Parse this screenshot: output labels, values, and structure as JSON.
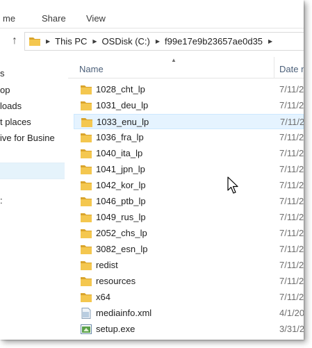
{
  "ribbon": {
    "tabs": [
      {
        "label": "me"
      },
      {
        "label": "Share"
      },
      {
        "label": "View"
      }
    ]
  },
  "address": {
    "crumbs": [
      "This PC",
      "OSDisk (C:)",
      "f99e17e9b23657ae0d35"
    ]
  },
  "nav": {
    "items": [
      {
        "label": "s"
      },
      {
        "label": "op"
      },
      {
        "label": "loads"
      },
      {
        "label": "t places"
      },
      {
        "label": "ive for Busine"
      },
      {
        "label": ":"
      }
    ]
  },
  "columns": {
    "name": "Name",
    "date": "Date m"
  },
  "files": [
    {
      "name": "1028_cht_lp",
      "date": "7/11/2",
      "type": "folder"
    },
    {
      "name": "1031_deu_lp",
      "date": "7/11/2",
      "type": "folder"
    },
    {
      "name": "1033_enu_lp",
      "date": "7/11/2",
      "type": "folder"
    },
    {
      "name": "1036_fra_lp",
      "date": "7/11/2",
      "type": "folder"
    },
    {
      "name": "1040_ita_lp",
      "date": "7/11/2",
      "type": "folder"
    },
    {
      "name": "1041_jpn_lp",
      "date": "7/11/2",
      "type": "folder"
    },
    {
      "name": "1042_kor_lp",
      "date": "7/11/2",
      "type": "folder"
    },
    {
      "name": "1046_ptb_lp",
      "date": "7/11/2",
      "type": "folder"
    },
    {
      "name": "1049_rus_lp",
      "date": "7/11/2",
      "type": "folder"
    },
    {
      "name": "2052_chs_lp",
      "date": "7/11/2",
      "type": "folder"
    },
    {
      "name": "3082_esn_lp",
      "date": "7/11/2",
      "type": "folder"
    },
    {
      "name": "redist",
      "date": "7/11/2",
      "type": "folder"
    },
    {
      "name": "resources",
      "date": "7/11/2",
      "type": "folder"
    },
    {
      "name": "x64",
      "date": "7/11/2",
      "type": "folder"
    },
    {
      "name": "mediainfo.xml",
      "date": "4/1/20",
      "type": "xml"
    },
    {
      "name": "setup.exe",
      "date": "3/31/2",
      "type": "exe"
    }
  ],
  "colors": {
    "folder": "#f4c74f",
    "folder_dark": "#d9a42c",
    "hover": "#e5f3ff",
    "header_text": "#4c607a"
  }
}
